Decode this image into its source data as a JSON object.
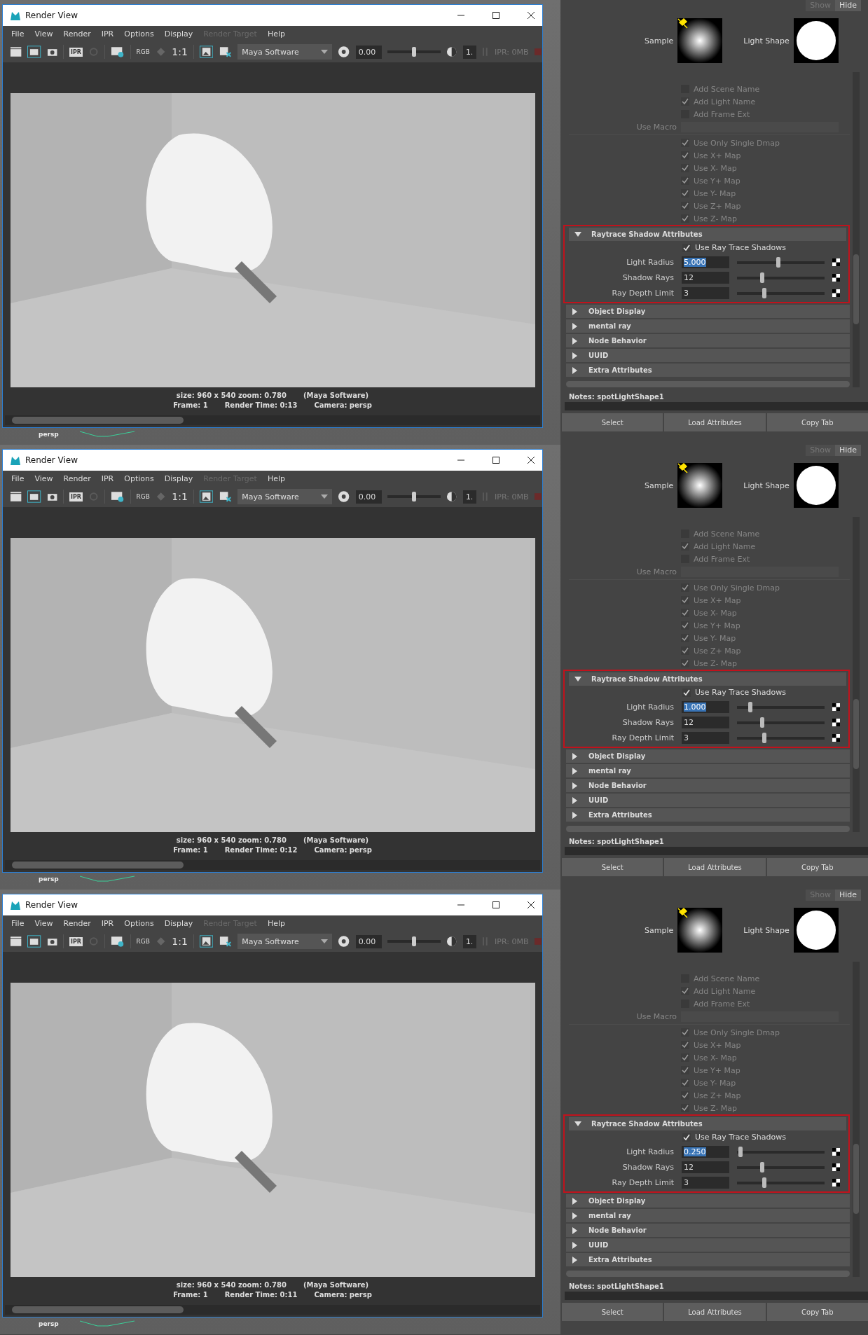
{
  "panels": [
    {
      "render_view": {
        "title": "Render View",
        "menu": [
          {
            "label": "File",
            "disabled": false
          },
          {
            "label": "View",
            "disabled": false
          },
          {
            "label": "Render",
            "disabled": false
          },
          {
            "label": "IPR",
            "disabled": false
          },
          {
            "label": "Options",
            "disabled": false
          },
          {
            "label": "Display",
            "disabled": false
          },
          {
            "label": "Render Target",
            "disabled": true
          },
          {
            "label": "Help",
            "disabled": false
          }
        ],
        "ipr_icon_label": "IPR",
        "rgb_label": "RGB",
        "ratio_label": "1:1",
        "renderer": "Maya Software",
        "exposure": {
          "value": "0.00",
          "level": 0.5
        },
        "gamma": "1.",
        "memory": "IPR: 0MB",
        "size_info": "size: 960 x 540 zoom: 0.780",
        "renderer_info": "(Maya Software)",
        "frame": "Frame: 1",
        "render_time": "Render Time: 0:13",
        "camera": "Camera: persp",
        "viewport_label": "persp"
      },
      "attribute_editor": {
        "tabs": [
          {
            "label": "Show",
            "selected": false
          },
          {
            "label": "Hide",
            "selected": true
          }
        ],
        "sample_label": "Sample",
        "light_shape_label": "Light Shape",
        "file_options": [
          {
            "label": "Add Scene Name",
            "checked": false
          },
          {
            "label": "Add Light Name",
            "checked": true
          },
          {
            "label": "Add Frame Ext",
            "checked": false
          }
        ],
        "macro_label": "Use Macro",
        "map_options": [
          {
            "label": "Use Only Single Dmap",
            "checked": true
          },
          {
            "label": "Use X+ Map",
            "checked": true
          },
          {
            "label": "Use X- Map",
            "checked": true
          },
          {
            "label": "Use Y+ Map",
            "checked": true
          },
          {
            "label": "Use Y- Map",
            "checked": true
          },
          {
            "label": "Use Z+ Map",
            "checked": true
          },
          {
            "label": "Use Z- Map",
            "checked": true
          }
        ],
        "raytrace": {
          "title": "Raytrace Shadow Attributes",
          "expanded": true,
          "use_raytrace": {
            "label": "Use Ray Trace Shadows",
            "checked": true
          },
          "sliders": [
            {
              "label": "Light Radius",
              "value": "5.000",
              "level": 0.47,
              "text_selected": true
            },
            {
              "label": "Shadow Rays",
              "value": "12",
              "level": 0.29,
              "text_selected": false
            },
            {
              "label": "Ray Depth Limit",
              "value": "3",
              "level": 0.31,
              "text_selected": false
            }
          ]
        },
        "sections": [
          {
            "label": "Object Display",
            "expanded": false
          },
          {
            "label": "mental ray",
            "expanded": false
          },
          {
            "label": "Node Behavior",
            "expanded": false
          },
          {
            "label": "UUID",
            "expanded": false
          },
          {
            "label": "Extra Attributes",
            "expanded": false
          }
        ],
        "notes": "Notes:  spotLightShape1",
        "buttons": [
          "Select",
          "Load Attributes",
          "Copy Tab"
        ]
      }
    },
    {
      "render_view": {
        "title": "Render View",
        "menu": [
          {
            "label": "File",
            "disabled": false
          },
          {
            "label": "View",
            "disabled": false
          },
          {
            "label": "Render",
            "disabled": false
          },
          {
            "label": "IPR",
            "disabled": false
          },
          {
            "label": "Options",
            "disabled": false
          },
          {
            "label": "Display",
            "disabled": false
          },
          {
            "label": "Render Target",
            "disabled": true
          },
          {
            "label": "Help",
            "disabled": false
          }
        ],
        "ipr_icon_label": "IPR",
        "rgb_label": "RGB",
        "ratio_label": "1:1",
        "renderer": "Maya Software",
        "exposure": {
          "value": "0.00",
          "level": 0.5
        },
        "gamma": "1.",
        "memory": "IPR: 0MB",
        "size_info": "size: 960 x 540 zoom: 0.780",
        "renderer_info": "(Maya Software)",
        "frame": "Frame: 1",
        "render_time": "Render Time: 0:12",
        "camera": "Camera: persp",
        "viewport_label": "persp"
      },
      "attribute_editor": {
        "tabs": [
          {
            "label": "Show",
            "selected": false
          },
          {
            "label": "Hide",
            "selected": true
          }
        ],
        "sample_label": "Sample",
        "light_shape_label": "Light Shape",
        "file_options": [
          {
            "label": "Add Scene Name",
            "checked": false
          },
          {
            "label": "Add Light Name",
            "checked": true
          },
          {
            "label": "Add Frame Ext",
            "checked": false
          }
        ],
        "macro_label": "Use Macro",
        "map_options": [
          {
            "label": "Use Only Single Dmap",
            "checked": true
          },
          {
            "label": "Use X+ Map",
            "checked": true
          },
          {
            "label": "Use X- Map",
            "checked": true
          },
          {
            "label": "Use Y+ Map",
            "checked": true
          },
          {
            "label": "Use Y- Map",
            "checked": true
          },
          {
            "label": "Use Z+ Map",
            "checked": true
          },
          {
            "label": "Use Z- Map",
            "checked": true
          }
        ],
        "raytrace": {
          "title": "Raytrace Shadow Attributes",
          "expanded": true,
          "use_raytrace": {
            "label": "Use Ray Trace Shadows",
            "checked": true
          },
          "sliders": [
            {
              "label": "Light Radius",
              "value": "1.000",
              "level": 0.15,
              "text_selected": true
            },
            {
              "label": "Shadow Rays",
              "value": "12",
              "level": 0.29,
              "text_selected": false
            },
            {
              "label": "Ray Depth Limit",
              "value": "3",
              "level": 0.31,
              "text_selected": false
            }
          ]
        },
        "sections": [
          {
            "label": "Object Display",
            "expanded": false
          },
          {
            "label": "mental ray",
            "expanded": false
          },
          {
            "label": "Node Behavior",
            "expanded": false
          },
          {
            "label": "UUID",
            "expanded": false
          },
          {
            "label": "Extra Attributes",
            "expanded": false
          }
        ],
        "notes": "Notes:  spotLightShape1",
        "buttons": [
          "Select",
          "Load Attributes",
          "Copy Tab"
        ]
      }
    },
    {
      "render_view": {
        "title": "Render View",
        "menu": [
          {
            "label": "File",
            "disabled": false
          },
          {
            "label": "View",
            "disabled": false
          },
          {
            "label": "Render",
            "disabled": false
          },
          {
            "label": "IPR",
            "disabled": false
          },
          {
            "label": "Options",
            "disabled": false
          },
          {
            "label": "Display",
            "disabled": false
          },
          {
            "label": "Render Target",
            "disabled": true
          },
          {
            "label": "Help",
            "disabled": false
          }
        ],
        "ipr_icon_label": "IPR",
        "rgb_label": "RGB",
        "ratio_label": "1:1",
        "renderer": "Maya Software",
        "exposure": {
          "value": "0.00",
          "level": 0.5
        },
        "gamma": "1.",
        "memory": "IPR: 0MB",
        "size_info": "size: 960 x 540 zoom: 0.780",
        "renderer_info": "(Maya Software)",
        "frame": "Frame: 1",
        "render_time": "Render Time: 0:11",
        "camera": "Camera: persp",
        "viewport_label": "persp"
      },
      "attribute_editor": {
        "tabs": [
          {
            "label": "Show",
            "selected": false
          },
          {
            "label": "Hide",
            "selected": true
          }
        ],
        "sample_label": "Sample",
        "light_shape_label": "Light Shape",
        "file_options": [
          {
            "label": "Add Scene Name",
            "checked": false
          },
          {
            "label": "Add Light Name",
            "checked": true
          },
          {
            "label": "Add Frame Ext",
            "checked": false
          }
        ],
        "macro_label": "Use Macro",
        "map_options": [
          {
            "label": "Use Only Single Dmap",
            "checked": true
          },
          {
            "label": "Use X+ Map",
            "checked": true
          },
          {
            "label": "Use X- Map",
            "checked": true
          },
          {
            "label": "Use Y+ Map",
            "checked": true
          },
          {
            "label": "Use Y- Map",
            "checked": true
          },
          {
            "label": "Use Z+ Map",
            "checked": true
          },
          {
            "label": "Use Z- Map",
            "checked": true
          }
        ],
        "raytrace": {
          "title": "Raytrace Shadow Attributes",
          "expanded": true,
          "use_raytrace": {
            "label": "Use Ray Trace Shadows",
            "checked": true
          },
          "sliders": [
            {
              "label": "Light Radius",
              "value": "0.250",
              "level": 0.04,
              "text_selected": true
            },
            {
              "label": "Shadow Rays",
              "value": "12",
              "level": 0.29,
              "text_selected": false
            },
            {
              "label": "Ray Depth Limit",
              "value": "3",
              "level": 0.31,
              "text_selected": false
            }
          ]
        },
        "sections": [
          {
            "label": "Object Display",
            "expanded": false
          },
          {
            "label": "mental ray",
            "expanded": false
          },
          {
            "label": "Node Behavior",
            "expanded": false
          },
          {
            "label": "UUID",
            "expanded": false
          },
          {
            "label": "Extra Attributes",
            "expanded": false
          }
        ],
        "notes": "Notes:  spotLightShape1",
        "buttons": [
          "Select",
          "Load Attributes",
          "Copy Tab"
        ]
      }
    }
  ]
}
